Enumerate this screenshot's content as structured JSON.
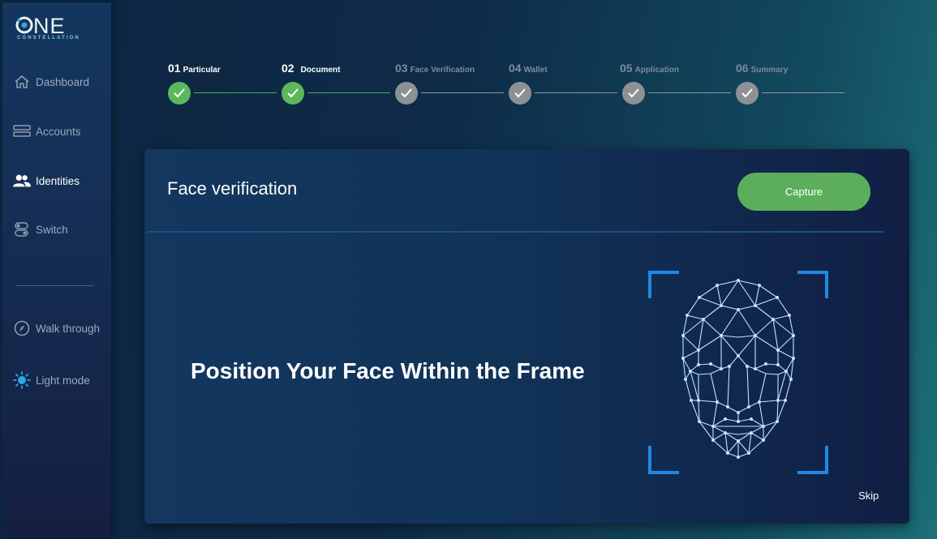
{
  "brand": {
    "logo_text": "NE",
    "logo_sub": "CONSTELLATION"
  },
  "sidebar": {
    "items": [
      {
        "label": "Dashboard",
        "icon": "home-icon",
        "active": false
      },
      {
        "label": "Accounts",
        "icon": "server-icon",
        "active": false
      },
      {
        "label": "Identities",
        "icon": "users-icon",
        "active": true
      },
      {
        "label": "Switch",
        "icon": "toggle-icon",
        "active": false
      }
    ],
    "secondary": [
      {
        "label": "Walk through",
        "icon": "compass-icon"
      },
      {
        "label": "Light mode",
        "icon": "sun-icon"
      }
    ]
  },
  "stepper": {
    "steps": [
      {
        "num": "01",
        "name": "Particular",
        "done": true
      },
      {
        "num": "02",
        "name": "Document",
        "done": true
      },
      {
        "num": "03",
        "name": "Face Verification",
        "done": false
      },
      {
        "num": "04",
        "name": "Wallet",
        "done": false
      },
      {
        "num": "05",
        "name": "Application",
        "done": false
      },
      {
        "num": "06",
        "name": "Summary",
        "done": false
      }
    ]
  },
  "card": {
    "title": "Face verification",
    "capture_label": "Capture",
    "instruction": "Position Your Face Within the Frame",
    "skip_label": "Skip"
  },
  "colors": {
    "accent_green": "#5cae5c",
    "frame_blue": "#1e88e5",
    "mesh": "#bfe6ff"
  }
}
